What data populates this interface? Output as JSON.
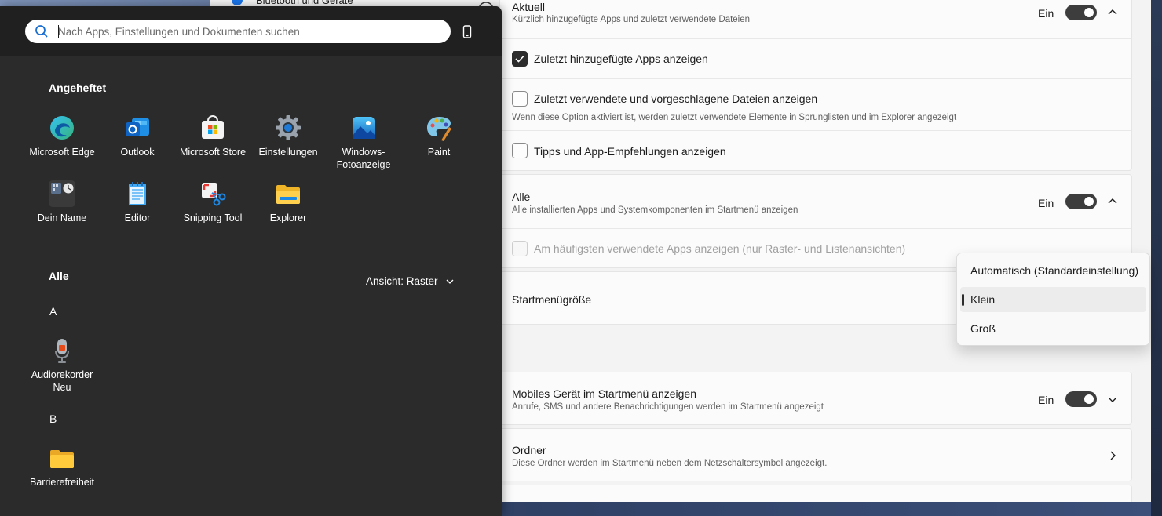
{
  "settings": {
    "bt_partial": "Bluetooth und Geräte",
    "aktuell": {
      "title": "Aktuell",
      "subtitle": "Kürzlich hinzugefügte Apps und zuletzt verwendete Dateien",
      "toggle_label": "Ein",
      "options": [
        {
          "label": "Zuletzt hinzugefügte Apps anzeigen",
          "checked": true
        },
        {
          "label": "Zuletzt verwendete und vorgeschlagene Dateien anzeigen",
          "checked": false,
          "hint": "Wenn diese Option aktiviert ist, werden zuletzt verwendete Elemente in Sprunglisten und im Explorer angezeigt"
        },
        {
          "label": "Tipps und App-Empfehlungen anzeigen",
          "checked": false
        }
      ]
    },
    "alle": {
      "title": "Alle",
      "subtitle": "Alle installierten Apps und Systemkomponenten im Startmenü anzeigen",
      "toggle_label": "Ein",
      "option": "Am häufigsten verwendete Apps anzeigen (nur Raster- und Listenansichten)"
    },
    "startmenu_size": {
      "title": "Startmenügröße",
      "options": [
        "Automatisch (Standardeinstellung)",
        "Klein",
        "Groß"
      ],
      "selected": "Klein"
    },
    "mobile": {
      "title": "Mobiles Gerät im Startmenü anzeigen",
      "subtitle": "Anrufe, SMS und andere Benachrichtigungen werden im Startmenü angezeigt",
      "toggle_label": "Ein"
    },
    "ordner": {
      "title": "Ordner",
      "subtitle": "Diese Ordner werden im Startmenü neben dem Netzschaltersymbol angezeigt."
    }
  },
  "start_menu": {
    "search_placeholder": "Nach Apps, Einstellungen und Dokumenten suchen",
    "pinned_title": "Angeheftet",
    "pinned": [
      {
        "name": "Microsoft Edge",
        "icon": "edge-icon"
      },
      {
        "name": "Outlook",
        "icon": "outlook-icon"
      },
      {
        "name": "Microsoft Store",
        "icon": "store-icon"
      },
      {
        "name": "Einstellungen",
        "icon": "settings-gear-icon"
      },
      {
        "name": "Windows-\nFotoanzeige",
        "icon": "photos-icon"
      },
      {
        "name": "Paint",
        "icon": "paint-icon"
      },
      {
        "name": "Dein Name",
        "icon": "folder-group-icon"
      },
      {
        "name": "Editor",
        "icon": "notepad-icon"
      },
      {
        "name": "Snipping Tool",
        "icon": "snipping-tool-icon"
      },
      {
        "name": "Explorer",
        "icon": "explorer-folder-icon"
      }
    ],
    "all_title": "Alle",
    "view_label": "Ansicht: Raster",
    "groups": [
      {
        "letter": "A",
        "apps": [
          {
            "name": "Audiorekorder",
            "badge": "Neu",
            "icon": "microphone-icon"
          }
        ]
      },
      {
        "letter": "B",
        "apps": [
          {
            "name": "Barrierefreiheit",
            "icon": "folder-icon"
          }
        ]
      }
    ]
  },
  "colors": {
    "start_bg": "#2b2b2b",
    "toggle_on": "#3d3d3d",
    "settings_bg": "#f3f3f3"
  }
}
